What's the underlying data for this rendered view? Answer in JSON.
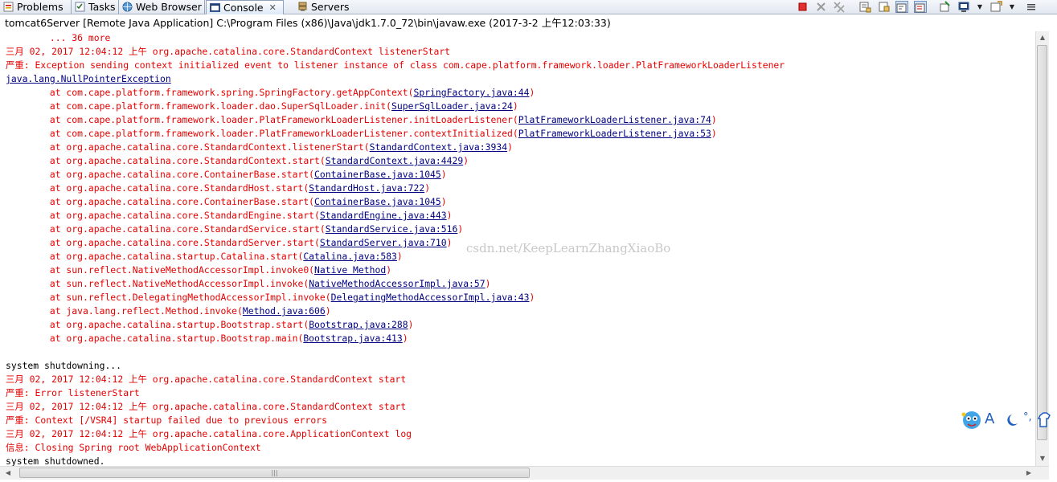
{
  "tabs": [
    {
      "label": "Problems",
      "icon": "problems-icon"
    },
    {
      "label": "Tasks",
      "icon": "tasks-icon"
    },
    {
      "label": "Web Browser",
      "icon": "globe-icon"
    },
    {
      "label": "Console",
      "icon": "console-icon",
      "close": "✕",
      "active": true
    },
    {
      "label": "Servers",
      "icon": "servers-icon"
    }
  ],
  "toolbar_icons": [
    "terminate-icon",
    "remove-launch-icon",
    "remove-all-icon",
    "clear-console-icon",
    "scroll-lock-icon",
    "word-wrap-icon",
    "show-on-output-icon",
    "pin-console-icon",
    "display-console-icon",
    "dropdown-icon",
    "open-console-icon",
    "dropdown-icon",
    "view-menu-icon"
  ],
  "header": {
    "title": "tomcat6Server [Remote Java Application] C:\\Program Files (x86)\\Java\\jdk1.7.0_72\\bin\\javaw.exe (2017-3-2 上午12:03:33)"
  },
  "console": {
    "lines": [
      [
        {
          "t": "        ... 36 more",
          "c": "red"
        }
      ],
      [
        {
          "t": "三月 02, 2017 12:04:12 上午 org.apache.catalina.core.StandardContext listenerStart",
          "c": "red"
        }
      ],
      [
        {
          "t": "严重: Exception sending context initialized event to listener instance of class com.cape.platform.framework.loader.PlatFrameworkLoaderListener",
          "c": "red"
        }
      ],
      [
        {
          "t": "java.lang.NullPointerException",
          "c": "lnk"
        }
      ],
      [
        {
          "t": "        at com.cape.platform.framework.spring.SpringFactory.getAppContext(",
          "c": "red"
        },
        {
          "t": "SpringFactory.java:44",
          "c": "lnk"
        },
        {
          "t": ")",
          "c": "red"
        }
      ],
      [
        {
          "t": "        at com.cape.platform.framework.loader.dao.SuperSqlLoader.init(",
          "c": "red"
        },
        {
          "t": "SuperSqlLoader.java:24",
          "c": "lnk"
        },
        {
          "t": ")",
          "c": "red"
        }
      ],
      [
        {
          "t": "        at com.cape.platform.framework.loader.PlatFrameworkLoaderListener.initLoaderListener(",
          "c": "red"
        },
        {
          "t": "PlatFrameworkLoaderListener.java:74",
          "c": "lnk"
        },
        {
          "t": ")",
          "c": "red"
        }
      ],
      [
        {
          "t": "        at com.cape.platform.framework.loader.PlatFrameworkLoaderListener.contextInitialized(",
          "c": "red"
        },
        {
          "t": "PlatFrameworkLoaderListener.java:53",
          "c": "lnk"
        },
        {
          "t": ")",
          "c": "red"
        }
      ],
      [
        {
          "t": "        at org.apache.catalina.core.StandardContext.listenerStart(",
          "c": "red"
        },
        {
          "t": "StandardContext.java:3934",
          "c": "lnk"
        },
        {
          "t": ")",
          "c": "red"
        }
      ],
      [
        {
          "t": "        at org.apache.catalina.core.StandardContext.start(",
          "c": "red"
        },
        {
          "t": "StandardContext.java:4429",
          "c": "lnk"
        },
        {
          "t": ")",
          "c": "red"
        }
      ],
      [
        {
          "t": "        at org.apache.catalina.core.ContainerBase.start(",
          "c": "red"
        },
        {
          "t": "ContainerBase.java:1045",
          "c": "lnk"
        },
        {
          "t": ")",
          "c": "red"
        }
      ],
      [
        {
          "t": "        at org.apache.catalina.core.StandardHost.start(",
          "c": "red"
        },
        {
          "t": "StandardHost.java:722",
          "c": "lnk"
        },
        {
          "t": ")",
          "c": "red"
        }
      ],
      [
        {
          "t": "        at org.apache.catalina.core.ContainerBase.start(",
          "c": "red"
        },
        {
          "t": "ContainerBase.java:1045",
          "c": "lnk"
        },
        {
          "t": ")",
          "c": "red"
        }
      ],
      [
        {
          "t": "        at org.apache.catalina.core.StandardEngine.start(",
          "c": "red"
        },
        {
          "t": "StandardEngine.java:443",
          "c": "lnk"
        },
        {
          "t": ")",
          "c": "red"
        }
      ],
      [
        {
          "t": "        at org.apache.catalina.core.StandardService.start(",
          "c": "red"
        },
        {
          "t": "StandardService.java:516",
          "c": "lnk"
        },
        {
          "t": ")",
          "c": "red"
        }
      ],
      [
        {
          "t": "        at org.apache.catalina.core.StandardServer.start(",
          "c": "red"
        },
        {
          "t": "StandardServer.java:710",
          "c": "lnk"
        },
        {
          "t": ")",
          "c": "red"
        }
      ],
      [
        {
          "t": "        at org.apache.catalina.startup.Catalina.start(",
          "c": "red"
        },
        {
          "t": "Catalina.java:583",
          "c": "lnk"
        },
        {
          "t": ")",
          "c": "red"
        }
      ],
      [
        {
          "t": "        at sun.reflect.NativeMethodAccessorImpl.invoke0(",
          "c": "red"
        },
        {
          "t": "Native Method",
          "c": "lnk"
        },
        {
          "t": ")",
          "c": "red"
        }
      ],
      [
        {
          "t": "        at sun.reflect.NativeMethodAccessorImpl.invoke(",
          "c": "red"
        },
        {
          "t": "NativeMethodAccessorImpl.java:57",
          "c": "lnk"
        },
        {
          "t": ")",
          "c": "red"
        }
      ],
      [
        {
          "t": "        at sun.reflect.DelegatingMethodAccessorImpl.invoke(",
          "c": "red"
        },
        {
          "t": "DelegatingMethodAccessorImpl.java:43",
          "c": "lnk"
        },
        {
          "t": ")",
          "c": "red"
        }
      ],
      [
        {
          "t": "        at java.lang.reflect.Method.invoke(",
          "c": "red"
        },
        {
          "t": "Method.java:606",
          "c": "lnk"
        },
        {
          "t": ")",
          "c": "red"
        }
      ],
      [
        {
          "t": "        at org.apache.catalina.startup.Bootstrap.start(",
          "c": "red"
        },
        {
          "t": "Bootstrap.java:288",
          "c": "lnk"
        },
        {
          "t": ")",
          "c": "red"
        }
      ],
      [
        {
          "t": "        at org.apache.catalina.startup.Bootstrap.main(",
          "c": "red"
        },
        {
          "t": "Bootstrap.java:413",
          "c": "lnk"
        },
        {
          "t": ")",
          "c": "red"
        }
      ],
      [
        {
          "t": "",
          "c": "blk"
        }
      ],
      [
        {
          "t": "system shutdowning...",
          "c": "blk"
        }
      ],
      [
        {
          "t": "三月 02, 2017 12:04:12 上午 org.apache.catalina.core.StandardContext start",
          "c": "red"
        }
      ],
      [
        {
          "t": "严重: Error listenerStart",
          "c": "red"
        }
      ],
      [
        {
          "t": "三月 02, 2017 12:04:12 上午 org.apache.catalina.core.StandardContext start",
          "c": "red"
        }
      ],
      [
        {
          "t": "严重: Context [/VSR4] startup failed due to previous errors",
          "c": "red"
        }
      ],
      [
        {
          "t": "三月 02, 2017 12:04:12 上午 org.apache.catalina.core.ApplicationContext log",
          "c": "red"
        }
      ],
      [
        {
          "t": "信息: Closing Spring root WebApplicationContext",
          "c": "red"
        }
      ],
      [
        {
          "t": "system shutdowned.",
          "c": "blk"
        }
      ]
    ]
  },
  "watermark": "csdn.net/KeepLearnZhangXiaoBo",
  "ime_toolbar": {
    "label": "A",
    "punct": "°,",
    "icons": [
      "ime-mascot-icon",
      "moon-icon",
      "shirt-icon"
    ]
  },
  "colors": {
    "error_text": "#e60000",
    "link_text": "#000080",
    "normal_text": "#000000",
    "active_tab": "#dde9f8"
  }
}
